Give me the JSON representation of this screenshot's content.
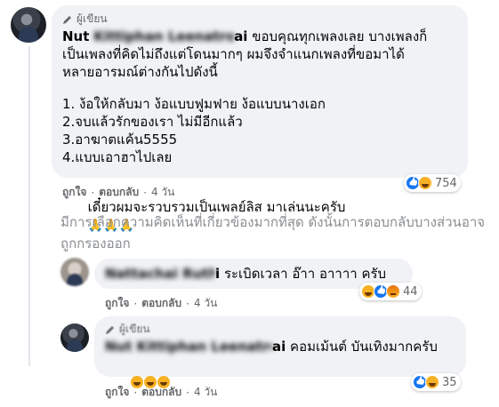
{
  "comment1": {
    "badge": "ผู้เขียน",
    "name_visible": "Nut",
    "name_blurred": "Kittiphan Leenatroopai",
    "name_tail": "ai",
    "intro": "ขอบคุณทุกเพลงเลย บางเพลงก็เป็นเพลงที่คิดไม่ถึงแต่โดนมากๆ ผมจึงจำแนกเพลงที่ขอมาได้หลายอารมณ์ต่างกันไปดังนี้",
    "line1": "ขอบคุณทุกเพลงเลย บางเพลงก็",
    "line2": "เป็นเพลงที่คิดไม่ถึงแต่โดนมากๆ ผมจึงจำแนกเพลงที่ขอมาได้",
    "line3": "หลายอารมณ์ต่างกันไปดังนี้",
    "list": [
      "1. ง้อให้กลับมา ง้อแบบฟูมฟาย ง้อแบบนางเอก",
      "2.จบแล้วรักของเรา ไม่มีอีกแล้ว",
      "3.อาฆาตแค้น5555",
      "4.แบบเอาฮาไปเลย"
    ],
    "closing": "เดี๋ยวผมจะรวบรวมเป็นเพลย์ลิส มาเล่นนะครับ",
    "pray_emoji": "🙏🙏🙏",
    "like": "ถูกใจ",
    "reply": "ตอบกลับ",
    "time": "4 วัน",
    "reaction_count": "754"
  },
  "notice": "มีการเลือกความคิดเห็นที่เกี่ยวข้องมากที่สุด ดังนั้นการตอบกลับบางส่วนอาจถูกกรองออก",
  "reply1": {
    "name_blurred": "Nattachai Ruthawi",
    "name_tail": "i",
    "text": "ระเบิดเวลา อ๊าา อาาาา ครับ",
    "like": "ถูกใจ",
    "reply": "ตอบกลับ",
    "time": "4 วัน",
    "reaction_count": "44"
  },
  "reply2": {
    "badge": "ผู้เขียน",
    "name_blurred": "Nut Kittiphan Leenatroopai",
    "name_tail": "ai",
    "text": "คอมเม้นต์ บันเทิงมากครับ",
    "like": "ถูกใจ",
    "reply": "ตอบกลับ",
    "time": "4 วัน",
    "reaction_count": "35"
  }
}
